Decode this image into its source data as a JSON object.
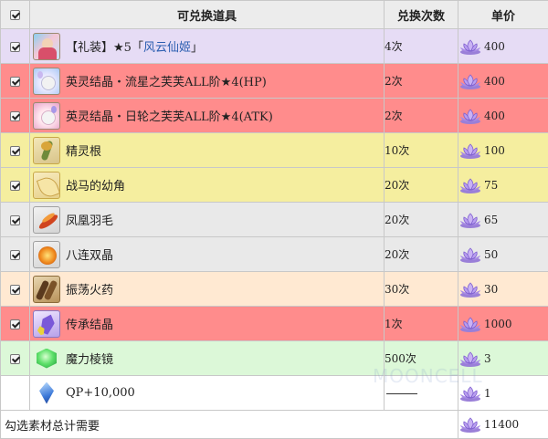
{
  "header": {
    "item_col": "可兑换道具",
    "count_col": "兑换次数",
    "price_col": "单价"
  },
  "currency_icon": "lotus-currency-icon",
  "rows": [
    {
      "checked": true,
      "name_prefix": "【礼装】",
      "star": "★",
      "name_mid": "5「",
      "name_link": "风云仙姬",
      "name_suffix": "」",
      "count": "4次",
      "price": "400",
      "color": "#e6dcf5",
      "icon": "craft-essence-fengyun-icon"
    },
    {
      "checked": true,
      "name": "英灵结晶・流星之芙芙ALL阶",
      "star": "★",
      "name_after": "4(HP)",
      "count": "2次",
      "price": "400",
      "color": "#ff8c8c",
      "icon": "fou-hp-icon"
    },
    {
      "checked": true,
      "name": "英灵结晶・日轮之芙芙ALL阶",
      "star": "★",
      "name_after": "4(ATK)",
      "count": "2次",
      "price": "400",
      "color": "#ff8c8c",
      "icon": "fou-atk-icon"
    },
    {
      "checked": true,
      "name": "精灵根",
      "count": "10次",
      "price": "100",
      "color": "#f5ee9f",
      "icon": "spirit-root-icon"
    },
    {
      "checked": true,
      "name": "战马的幼角",
      "count": "20次",
      "price": "75",
      "color": "#f5ee9f",
      "icon": "warhorse-horn-icon"
    },
    {
      "checked": true,
      "name": "凤凰羽毛",
      "count": "20次",
      "price": "65",
      "color": "#e9e9e9",
      "icon": "phoenix-feather-icon"
    },
    {
      "checked": true,
      "name": "八连双晶",
      "count": "20次",
      "price": "50",
      "color": "#e9e9e9",
      "icon": "octuplet-crystal-icon"
    },
    {
      "checked": true,
      "name": "振荡火药",
      "count": "30次",
      "price": "30",
      "color": "#ffe9d2",
      "icon": "gunpowder-icon"
    },
    {
      "checked": true,
      "name": "传承结晶",
      "count": "1次",
      "price": "1000",
      "color": "#ff8c8c",
      "icon": "inheritance-crystal-icon"
    },
    {
      "checked": true,
      "name": "魔力棱镜",
      "count": "500次",
      "price": "3",
      "color": "#dcf8d8",
      "icon": "mana-prism-icon"
    },
    {
      "checked": false,
      "name": "QP+10,000",
      "count": "",
      "price": "1",
      "color": "#ffffff",
      "icon": "qp-crystal-icon"
    }
  ],
  "total": {
    "label": "勾选素材总计需要",
    "value": "11400"
  },
  "watermark": "MOONCELL"
}
